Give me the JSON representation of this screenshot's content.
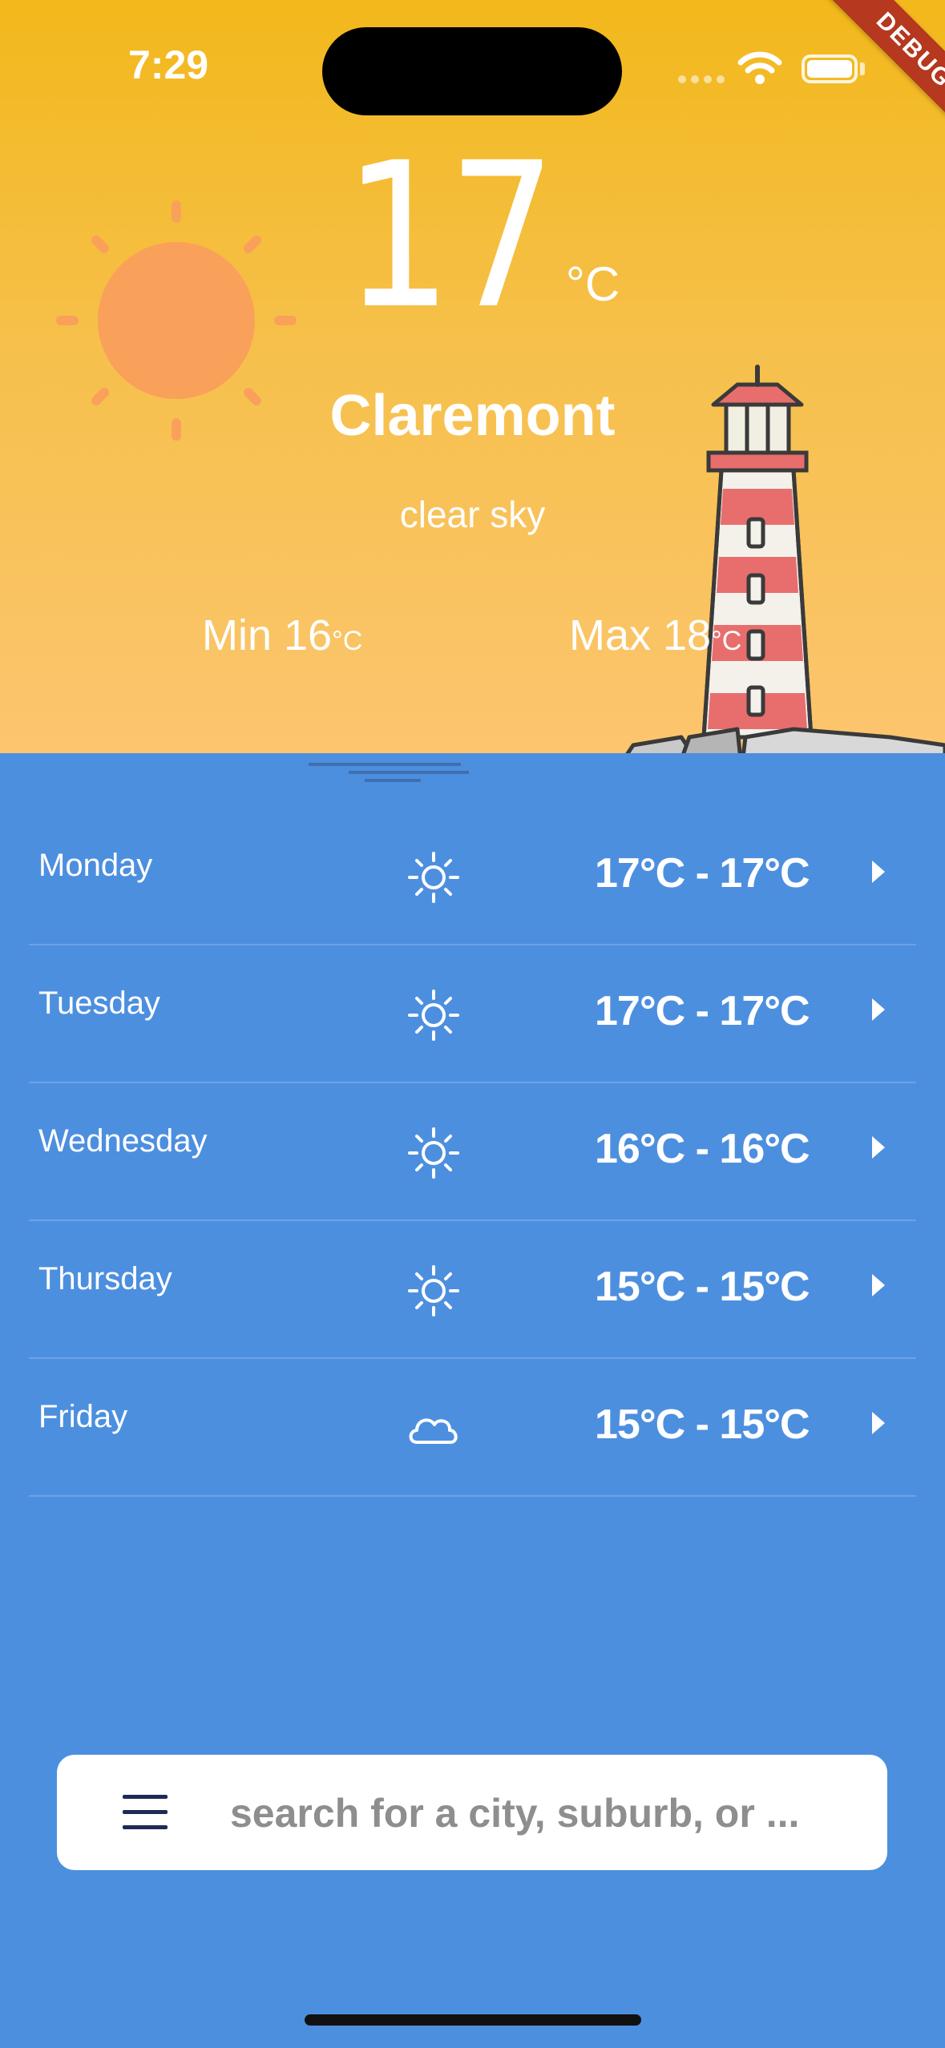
{
  "status_bar": {
    "time": "7:29"
  },
  "debug_label": "DEBUG",
  "current": {
    "temperature": "17",
    "unit": "°C",
    "city": "Claremont",
    "condition": "clear sky",
    "min_label": "Min 16",
    "max_label": "Max 18",
    "small_unit": "°C"
  },
  "forecast": [
    {
      "day": "Monday",
      "icon": "sun-icon",
      "range": "17°C - 17°C"
    },
    {
      "day": "Tuesday",
      "icon": "sun-icon",
      "range": "17°C - 17°C"
    },
    {
      "day": "Wednesday",
      "icon": "sun-icon",
      "range": "16°C - 16°C"
    },
    {
      "day": "Thursday",
      "icon": "sun-icon",
      "range": "15°C - 15°C"
    },
    {
      "day": "Friday",
      "icon": "cloud-icon",
      "range": "15°C - 15°C"
    }
  ],
  "search": {
    "placeholder": "search for a city, suburb, or ..."
  },
  "colors": {
    "sky_top": "#f2b81b",
    "sky_bottom": "#fcc56f",
    "sea": "#4d8fdf",
    "sun": "#f9a15a",
    "lighthouse_red": "#e86e6e"
  }
}
